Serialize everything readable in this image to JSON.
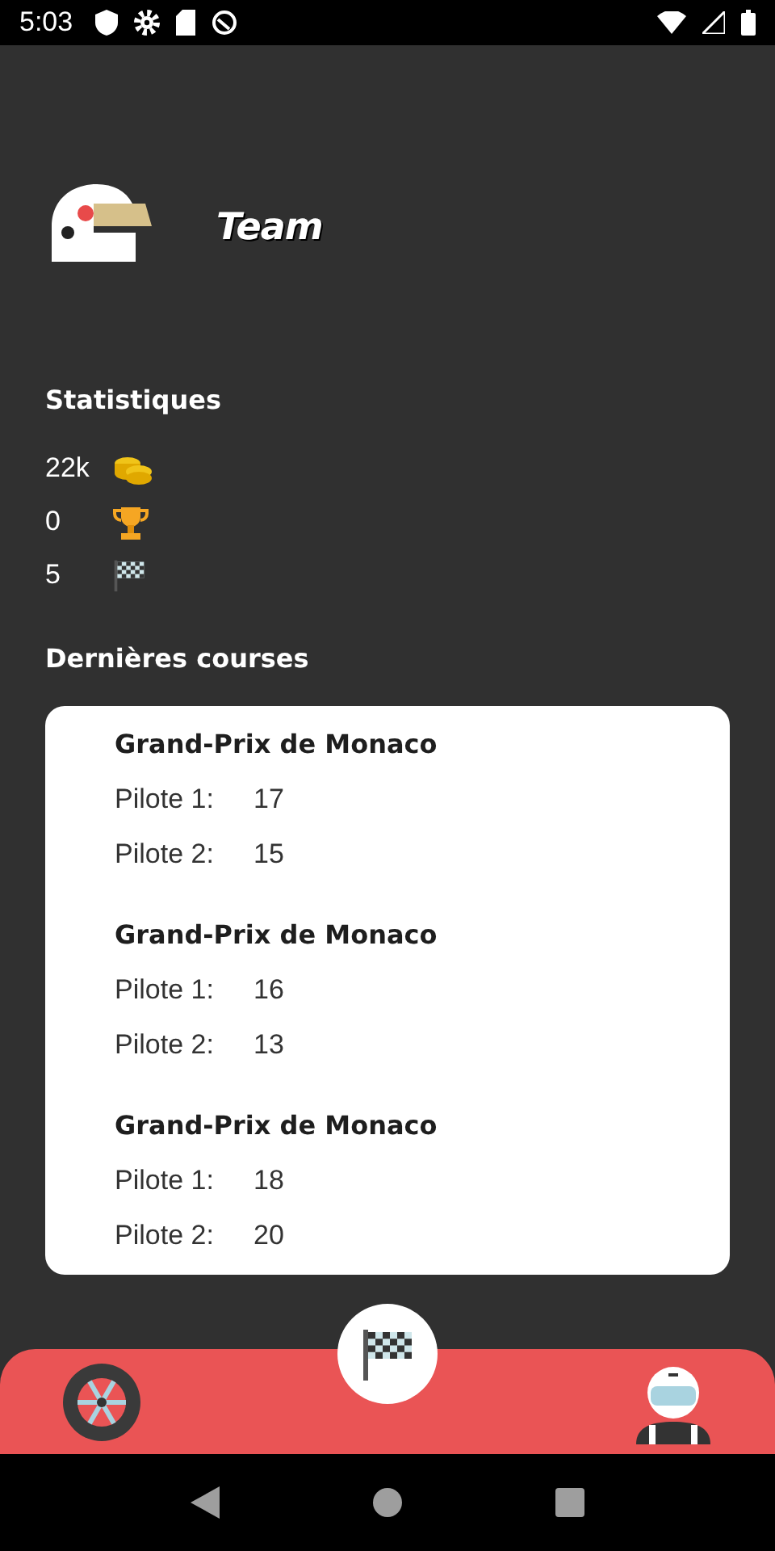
{
  "status_bar": {
    "time": "5:03"
  },
  "header": {
    "title": "Team"
  },
  "stats": {
    "title": "Statistiques",
    "items": [
      {
        "kind": "coins",
        "value": "22k"
      },
      {
        "kind": "trophy",
        "value": "0"
      },
      {
        "kind": "flag",
        "value": "5"
      }
    ]
  },
  "races": {
    "title": "Dernières courses",
    "items": [
      {
        "name": "Grand-Prix de Monaco",
        "results": [
          {
            "label": "Pilote 1:",
            "value": "17"
          },
          {
            "label": "Pilote 2:",
            "value": "15"
          }
        ]
      },
      {
        "name": "Grand-Prix de Monaco",
        "results": [
          {
            "label": "Pilote 1:",
            "value": "16"
          },
          {
            "label": "Pilote 2:",
            "value": "13"
          }
        ]
      },
      {
        "name": "Grand-Prix de Monaco",
        "results": [
          {
            "label": "Pilote 1:",
            "value": "18"
          },
          {
            "label": "Pilote 2:",
            "value": "20"
          }
        ]
      }
    ]
  }
}
